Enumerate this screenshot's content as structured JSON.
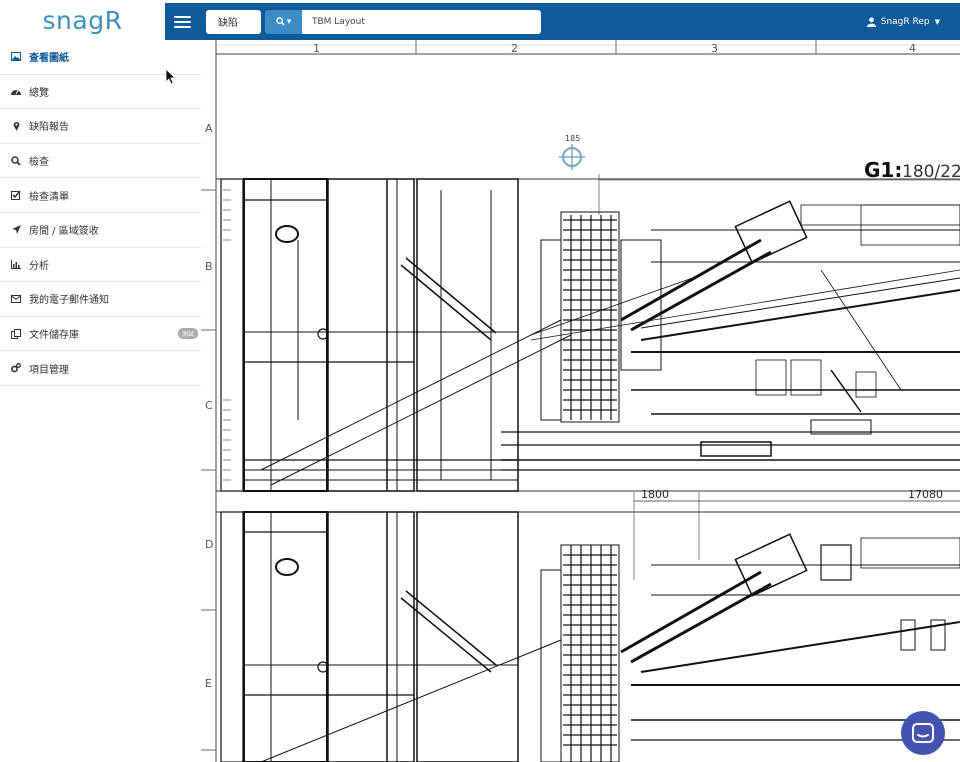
{
  "brand": {
    "logo_text": "snagR"
  },
  "topbar": {
    "filter_value": "缺陷",
    "search_value": "TBM Layout",
    "user_name": "SnagR Rep"
  },
  "sidebar": {
    "items": [
      {
        "label": "查看圖紙",
        "icon": "image-icon",
        "active": true
      },
      {
        "label": "總覽",
        "icon": "dashboard-icon"
      },
      {
        "label": "缺陷報告",
        "icon": "map-marker-icon"
      },
      {
        "label": "檢查",
        "icon": "search-icon"
      },
      {
        "label": "檢查清單",
        "icon": "checkbox-icon"
      },
      {
        "label": "房間 / 區域簽收",
        "icon": "location-arrow-icon"
      },
      {
        "label": "分析",
        "icon": "bar-chart-icon"
      },
      {
        "label": "我的電子郵件通知",
        "icon": "envelope-icon"
      },
      {
        "label": "文件儲存庫",
        "icon": "files-icon",
        "badge": "測試"
      },
      {
        "label": "項目管理",
        "icon": "cogs-icon"
      }
    ]
  },
  "drawing": {
    "columns": [
      "1",
      "2",
      "3",
      "4"
    ],
    "rows": [
      "A",
      "B",
      "C",
      "D",
      "E"
    ],
    "pin_label": "185",
    "section_title": "G1:",
    "section_scale": "180/22",
    "dim_1": "1800",
    "dim_2": "17080"
  },
  "colors": {
    "topbar": "#0f5b99",
    "accent": "#3a8dc6",
    "chat": "#4453b0"
  }
}
